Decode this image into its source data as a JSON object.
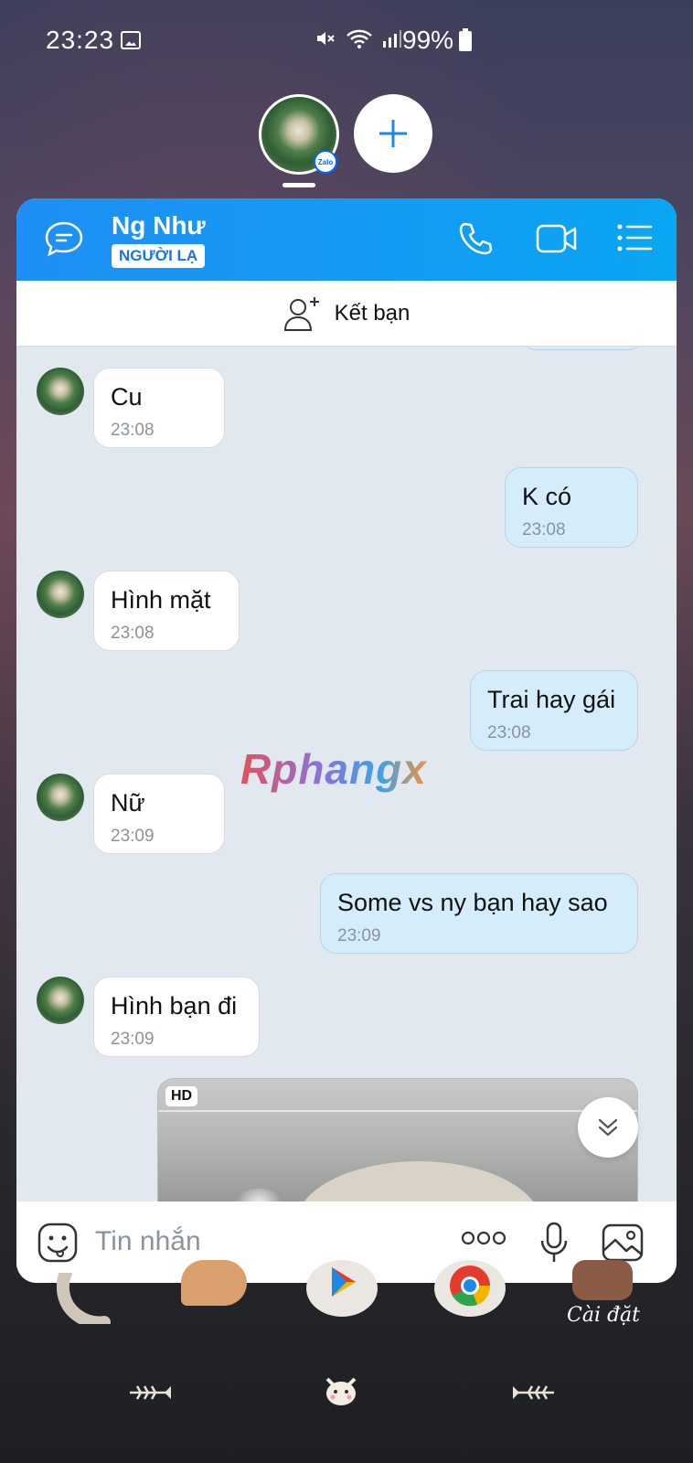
{
  "status_bar": {
    "time": "23:23",
    "battery_pct": "99%"
  },
  "floating": {
    "badge_text": "Zalo"
  },
  "header": {
    "contact_name": "Ng Như",
    "contact_badge": "NGƯỜI LẠ"
  },
  "add_friend": {
    "label": "Kết bạn"
  },
  "messages": [
    {
      "direction": "in",
      "text": "Cu",
      "time": "23:08"
    },
    {
      "direction": "out",
      "text": "K có",
      "time": "23:08"
    },
    {
      "direction": "in",
      "text": "Hình mặt",
      "time": "23:08"
    },
    {
      "direction": "out",
      "text": "Trai hay gái",
      "time": "23:08"
    },
    {
      "direction": "in",
      "text": "Nữ",
      "time": "23:09"
    },
    {
      "direction": "out",
      "text": "Some vs ny bạn hay sao",
      "time": "23:09"
    },
    {
      "direction": "in",
      "text": "Hình bạn đi",
      "time": "23:09"
    }
  ],
  "media": {
    "quality_badge": "HD"
  },
  "watermark": "Rphangx",
  "input": {
    "placeholder": "Tin nhắn"
  },
  "dock": {
    "settings_label": "Cài đặt"
  },
  "colors": {
    "header_start": "#1f8ff5",
    "header_end": "#0aa6f2",
    "incoming_bubble": "#ffffff",
    "outgoing_bubble": "#d5ecfb",
    "chat_background": "#e2e8ef"
  }
}
